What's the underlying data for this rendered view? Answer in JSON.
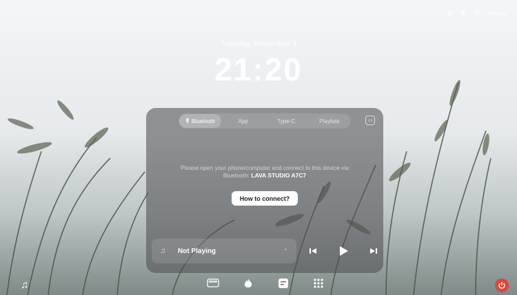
{
  "status": {
    "settings_label": "Settings"
  },
  "lockscreen": {
    "date": "Tuesday, November 4",
    "time": "21:20"
  },
  "panel": {
    "tabs": [
      {
        "label": "Bluetooth",
        "active": true
      },
      {
        "label": "App",
        "active": false
      },
      {
        "label": "Type-C",
        "active": false
      },
      {
        "label": "Playlists",
        "active": false
      }
    ],
    "info_line1": "Please open your phone/computer and connect to this device via",
    "info_prefix": "Bluetooth: ",
    "device_name": "LAVA STUDIO A7C7",
    "help_button": "How to connect?"
  },
  "player": {
    "title": "Not Playing"
  },
  "icons": {
    "bluetooth": "bluetooth-icon",
    "wifi": "wifi-icon",
    "music": "music-note-icon",
    "prev": "skip-previous-icon",
    "play": "play-icon",
    "next": "skip-next-icon"
  },
  "colors": {
    "accent_red": "#d9483b",
    "panel_bg": "#505052",
    "button_bg": "#ffffff"
  }
}
